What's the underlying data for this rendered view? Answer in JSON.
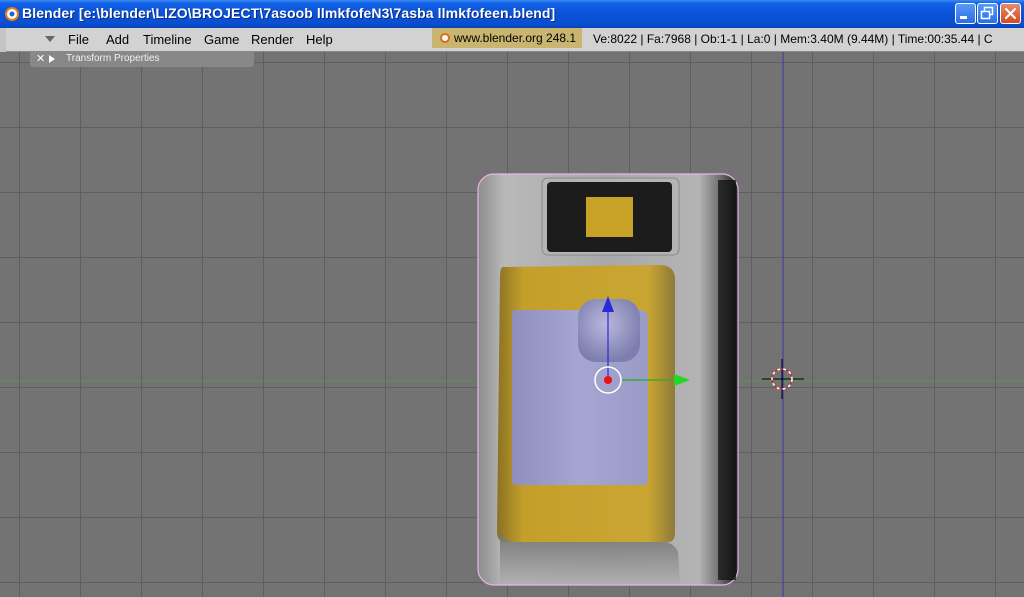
{
  "window": {
    "title": "Blender [e:\\blender\\LIZO\\BROJECT\\7asoob llmkfofeN3\\7asba llmkfofeen.blend]",
    "controls": [
      "minimize-icon",
      "restore-icon",
      "close-icon"
    ]
  },
  "menubar": {
    "items": [
      "File",
      "Add",
      "Timeline",
      "Game",
      "Render",
      "Help"
    ],
    "info_url": "www.blender.org 248.1",
    "stats": "Ve:8022 | Fa:7968 | Ob:1-1 | La:0  | Mem:3.40M (9.44M)  | Time:00:35.44 | C"
  },
  "viewport": {
    "panel_label": "Transform Properties",
    "colors": {
      "background": "#737373",
      "grid": "#5e5e5e",
      "x_axis": "#4e9a4e",
      "y_axis": "#3a3aa8",
      "object_body": "#9a9a9a",
      "object_yellow": "#c8a227",
      "object_lavender": "#a0a0cc",
      "selection_outline": "#e8b4e8"
    },
    "icons": [
      "3d-cursor-icon",
      "object-origin-icon",
      "z-arrow-icon",
      "y-arrow-icon"
    ]
  }
}
